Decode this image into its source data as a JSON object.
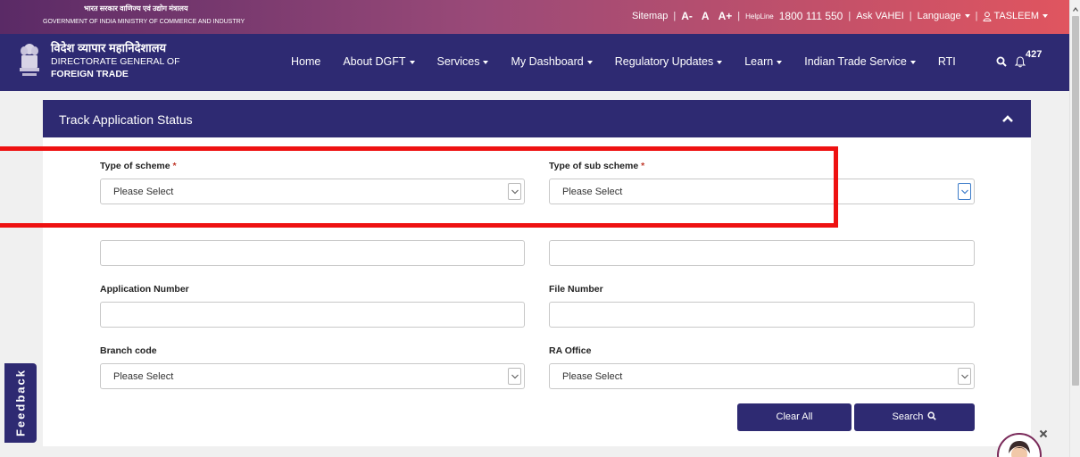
{
  "gov": {
    "hindi_line": "भारत सरकार वाणिज्य एवं उद्योग मंत्रालय",
    "english_line": "GOVERNMENT OF INDIA  MINISTRY OF COMMERCE AND INDUSTRY"
  },
  "top_links": {
    "sitemap": "Sitemap",
    "sep": "|",
    "font_small": "A-",
    "font_normal": "A",
    "font_large": "A+",
    "helpline_label": "HelpLine",
    "helpline_number": "1800 111 550",
    "ask_vahei": "Ask VAHEI",
    "language": "Language",
    "user": "TASLEEM"
  },
  "brand": {
    "hindi": "विदेश व्यापार महानिदेशालय",
    "line1": "DIRECTORATE GENERAL OF",
    "line2": "FOREIGN TRADE"
  },
  "nav": {
    "home": "Home",
    "about": "About DGFT",
    "services": "Services",
    "dashboard": "My Dashboard",
    "regulatory": "Regulatory Updates",
    "learn": "Learn",
    "its": "Indian Trade Service",
    "rti": "RTI",
    "notification_count": "427"
  },
  "card": {
    "title": "Track Application Status"
  },
  "form": {
    "type_of_scheme_label": "Type of scheme",
    "type_of_sub_scheme_label": "Type of sub scheme",
    "required_mark": "*",
    "scheme_value": "Please Select",
    "sub_scheme_value": "Please Select",
    "application_number_label": "Application Number",
    "file_number_label": "File Number",
    "branch_code_label": "Branch code",
    "ra_office_label": "RA Office",
    "branch_code_value": "Please Select",
    "ra_office_value": "Please Select",
    "clear_all": "Clear All",
    "search": "Search"
  },
  "feedback": {
    "label": "Feedback"
  },
  "colors": {
    "primary_navy": "#2e2a72",
    "highlight_red": "#ee1111",
    "required_red": "#c0392b"
  }
}
